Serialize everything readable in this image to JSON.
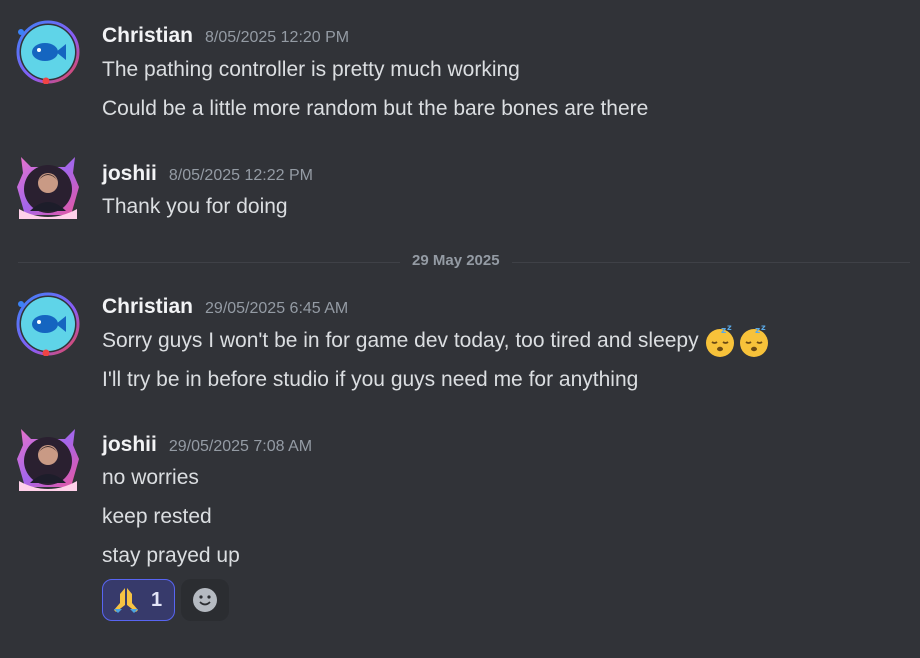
{
  "messages": [
    {
      "author": "Christian",
      "timestamp": "8/05/2025 12:20 PM",
      "avatar_icon": "fish-icon",
      "lines": [
        "The pathing controller is pretty much working",
        "Could be a little more random but the bare bones are there"
      ]
    },
    {
      "author": "joshii",
      "timestamp": "8/05/2025 12:22 PM",
      "avatar_icon": "user-photo-avatar",
      "lines": [
        "Thank you for doing"
      ]
    },
    {
      "author": "Christian",
      "timestamp": "29/05/2025 6:45 AM",
      "avatar_icon": "fish-icon",
      "lines": [
        "Sorry guys I won't be in for game dev today, too tired and sleepy",
        "I'll try be in before studio if you guys need me for anything"
      ],
      "emojis": [
        "sleeping-face-emoji",
        "sleeping-face-emoji"
      ]
    },
    {
      "author": "joshii",
      "timestamp": "29/05/2025 7:08 AM",
      "avatar_icon": "user-photo-avatar",
      "lines": [
        "no worries",
        "keep rested",
        "stay prayed up"
      ],
      "reactions": [
        {
          "emoji": "folded-hands-emoji",
          "count": "1"
        }
      ]
    }
  ],
  "date_divider": "29 May 2025",
  "colors": {
    "background": "#313338",
    "username": "#f2f3f5",
    "timestamp": "#949ba4",
    "text": "#dbdee1",
    "reaction_bg": "#373a6b",
    "reaction_border": "#5865f2"
  }
}
